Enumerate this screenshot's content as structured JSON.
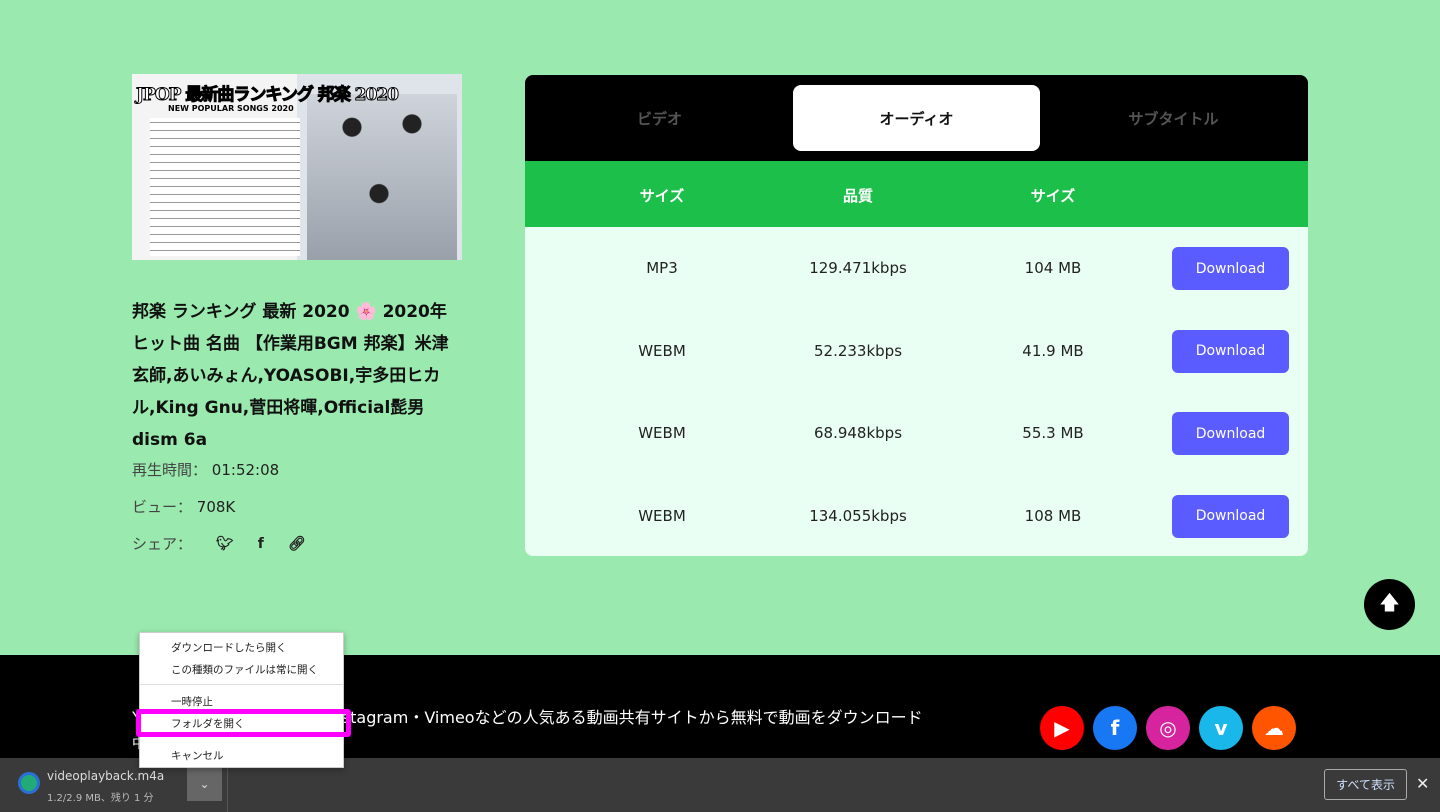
{
  "video": {
    "thumb_title": "JPOP 最新曲ランキング 邦楽 2020",
    "thumb_subtitle": "NEW POPULAR SONGS 2020",
    "title": "邦楽 ランキング 最新 2020 🌸 2020年ヒット曲 名曲 【作業用BGM 邦楽】米津玄師,あいみょん,YOASOBI,宇多田ヒカル,King Gnu,菅田将暉,Official髭男dism 6a",
    "duration_label": "再生時間：",
    "duration": "01:52:08",
    "views_label": "ビュー：",
    "views": "708K",
    "share_label": "シェア："
  },
  "tabs": [
    {
      "label": "ビデオ"
    },
    {
      "label": "オーディオ",
      "active": true
    },
    {
      "label": "サブタイトル"
    }
  ],
  "table": {
    "headers": [
      "サイズ",
      "品質",
      "サイズ"
    ],
    "rows": [
      {
        "format": "MP3",
        "quality": "129.471kbps",
        "size": "104 MB",
        "action": "Download"
      },
      {
        "format": "WEBM",
        "quality": "52.233kbps",
        "size": "41.9 MB",
        "action": "Download"
      },
      {
        "format": "WEBM",
        "quality": "68.948kbps",
        "size": "55.3 MB",
        "action": "Download"
      },
      {
        "format": "WEBM",
        "quality": "134.055kbps",
        "size": "108 MB",
        "action": "Download"
      }
    ]
  },
  "footer": {
    "text": "stagram・Vimeoなどの人気ある動画共有サイトから無料で動画をダウンロード",
    "text_prefix": "Y",
    "line2": "中",
    "social": [
      {
        "icon": "youtube-icon",
        "color": "#ff0000",
        "glyph": "▶"
      },
      {
        "icon": "facebook-icon",
        "color": "#1877f2",
        "glyph": "f"
      },
      {
        "icon": "instagram-icon",
        "color": "#d6249f",
        "glyph": "◎"
      },
      {
        "icon": "vimeo-icon",
        "color": "#1ab7ea",
        "glyph": "v"
      },
      {
        "icon": "soundcloud-icon",
        "color": "#ff5500",
        "glyph": "☁"
      }
    ]
  },
  "download_bar": {
    "filename": "videoplayback.m4a",
    "status": "1.2/2.9 MB、残り 1 分",
    "show_all": "すべて表示"
  },
  "context_menu": {
    "items": [
      "ダウンロードしたら開く",
      "この種類のファイルは常に開く",
      "一時停止",
      "フォルダを開く",
      "キャンセル"
    ]
  }
}
